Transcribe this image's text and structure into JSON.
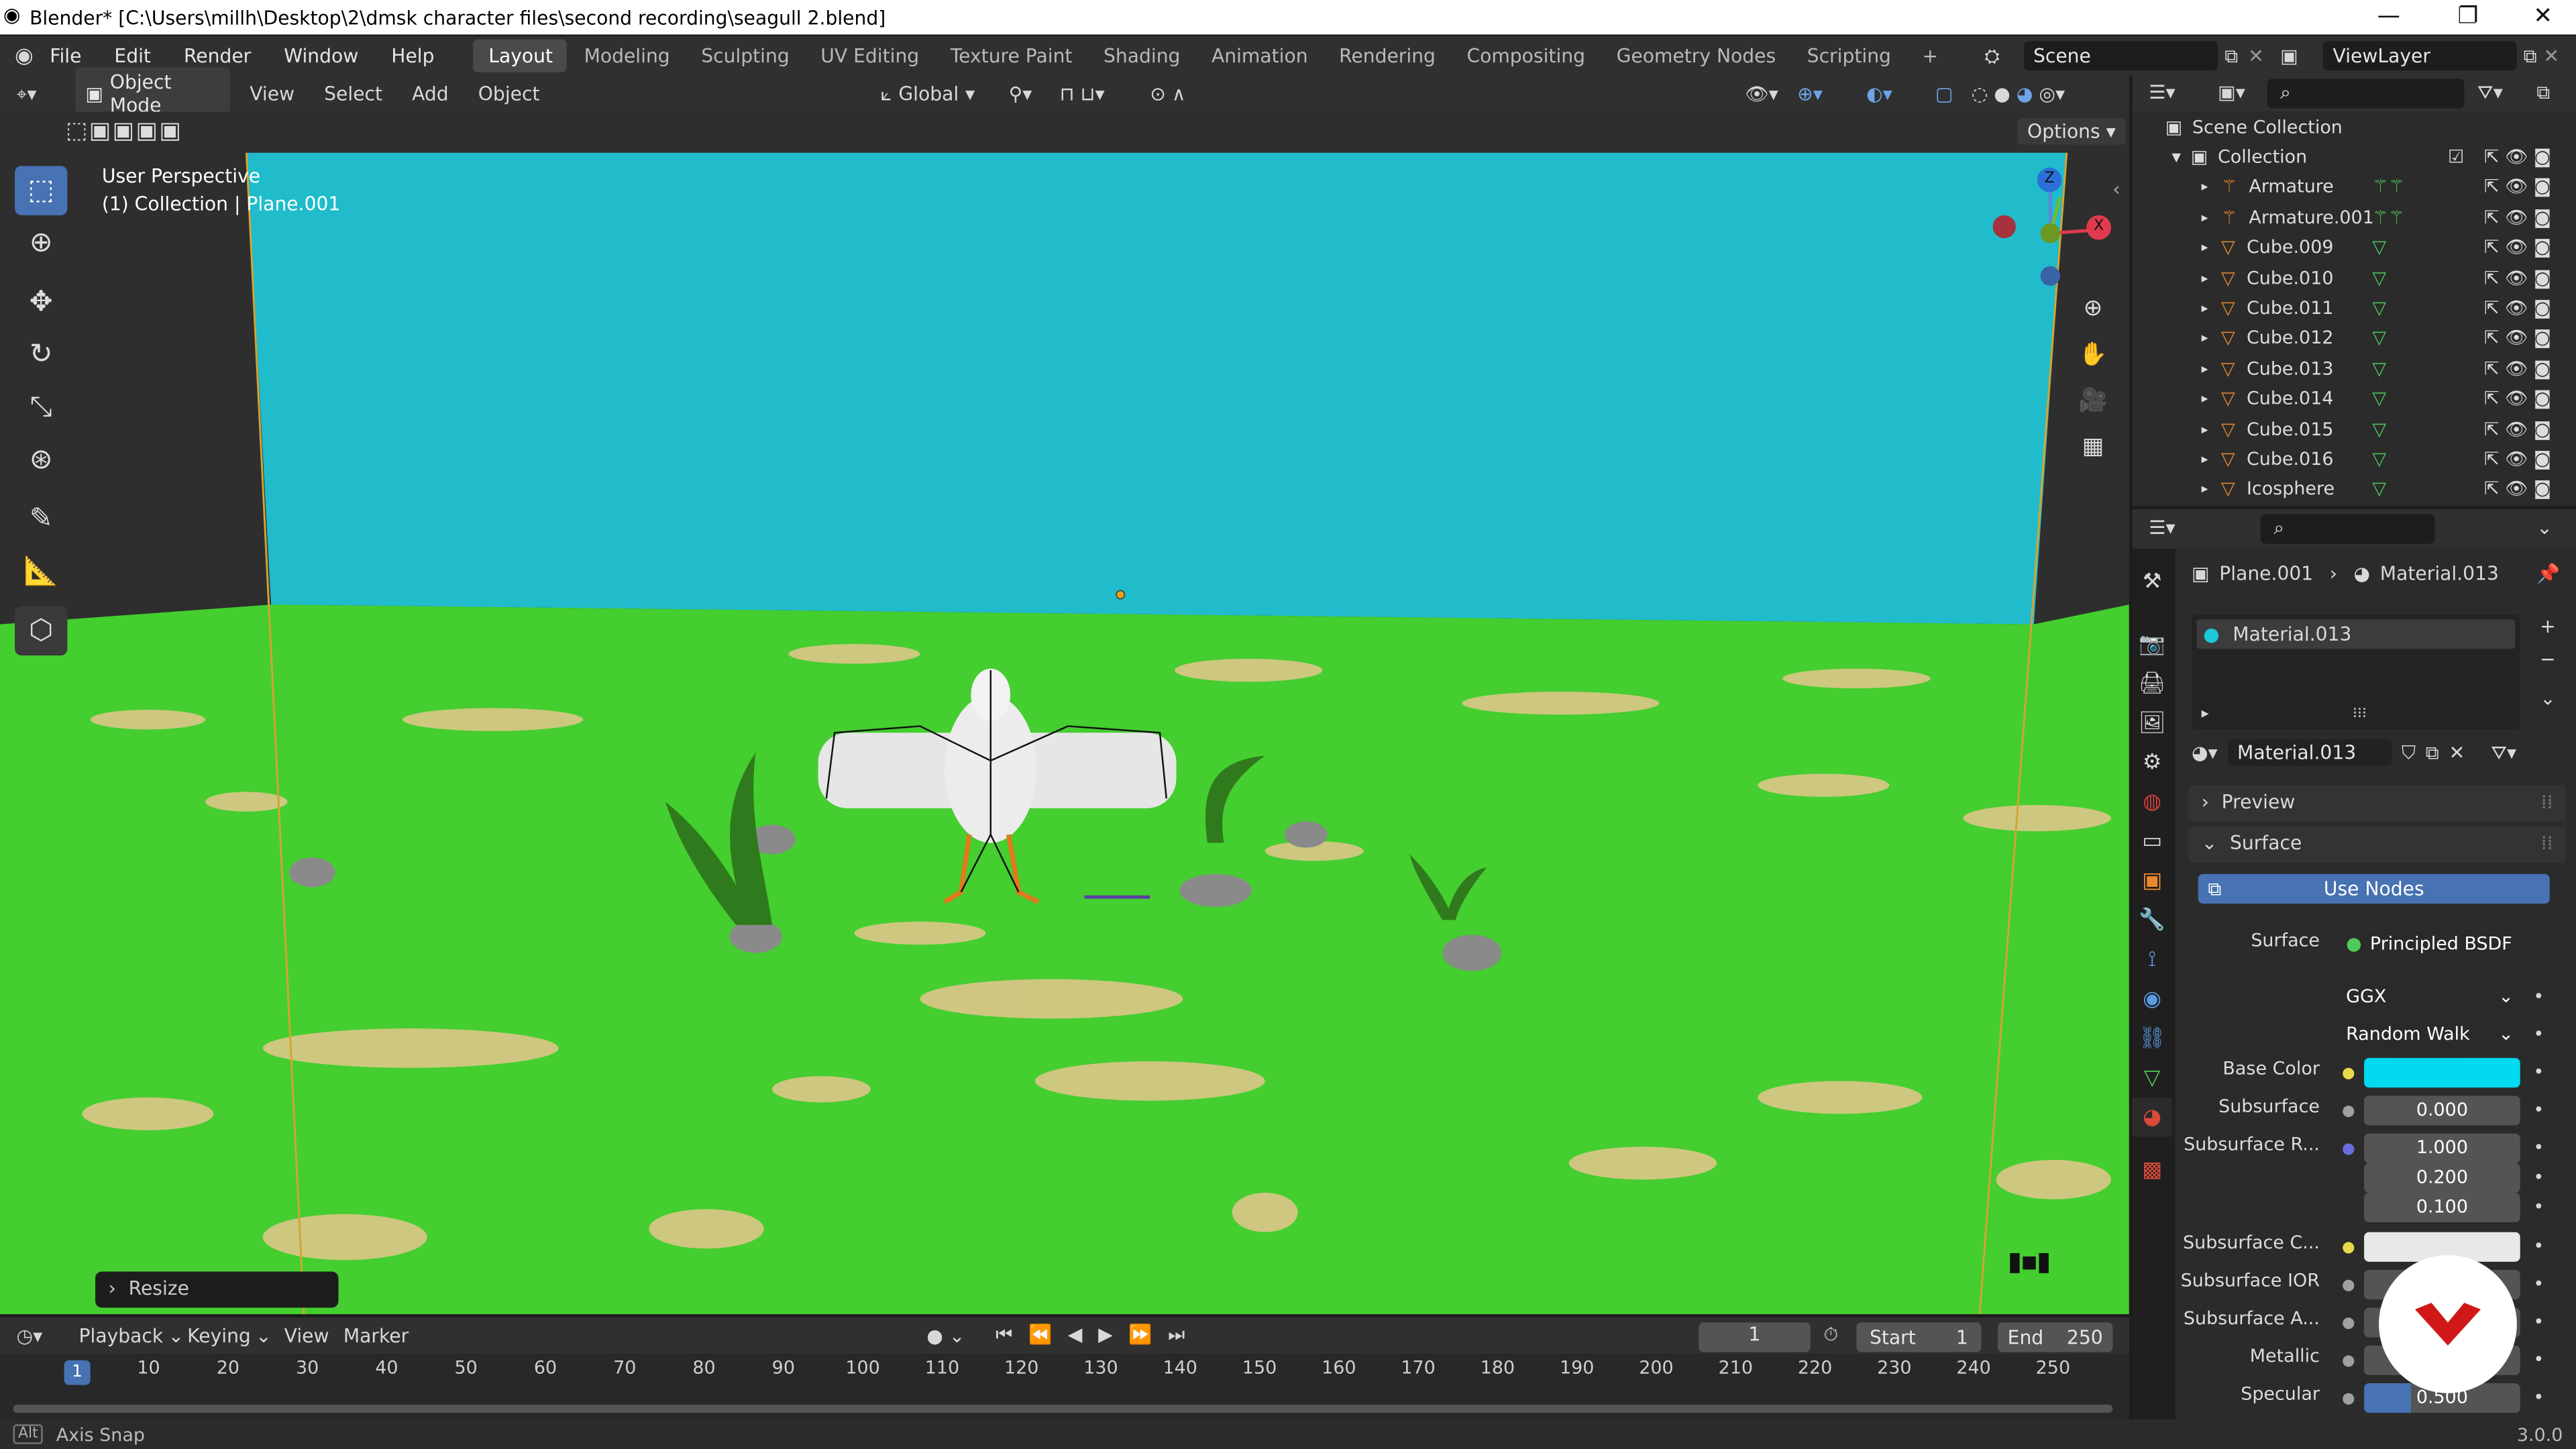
{
  "window": {
    "title": "Blender* [C:\\Users\\millh\\Desktop\\2\\dmsk character files\\second recording\\seagull 2.blend]"
  },
  "menu": [
    "File",
    "Edit",
    "Render",
    "Window",
    "Help"
  ],
  "workspaces": [
    "Layout",
    "Modeling",
    "Sculpting",
    "UV Editing",
    "Texture Paint",
    "Shading",
    "Animation",
    "Rendering",
    "Compositing",
    "Geometry Nodes",
    "Scripting"
  ],
  "active_workspace": "Layout",
  "scene": "Scene",
  "view_layer": "ViewLayer",
  "viewport_header": {
    "mode": "Object Mode",
    "menus": [
      "View",
      "Select",
      "Add",
      "Object"
    ],
    "orientation": "Global",
    "options": "Options"
  },
  "viewport": {
    "view_name": "User Perspective",
    "context": "(1) Collection | Plane.001",
    "operator_panel": "Resize",
    "gizmo": {
      "z": "Z",
      "x": "X"
    }
  },
  "outliner": {
    "root": "Scene Collection",
    "collection": "Collection",
    "items": [
      "Armature",
      "Armature.001",
      "Cube.009",
      "Cube.010",
      "Cube.011",
      "Cube.012",
      "Cube.013",
      "Cube.014",
      "Cube.015",
      "Cube.016",
      "Icosphere"
    ]
  },
  "properties": {
    "breadcrumb_object": "Plane.001",
    "breadcrumb_material": "Material.013",
    "slot": "Material.013",
    "material_name": "Material.013",
    "preview": "Preview",
    "surface_panel": "Surface",
    "use_nodes": "Use Nodes",
    "surface_label": "Surface",
    "surface_shader": "Principled BSDF",
    "distribution": "GGX",
    "subsurface_method": "Random Walk",
    "fields": [
      {
        "label": "Base Color",
        "value": "",
        "color": "#00d9f0",
        "dot": "#e8d94a"
      },
      {
        "label": "Subsurface",
        "value": "0.000",
        "dot": "#a0a0a0"
      },
      {
        "label": "Subsurface R...",
        "value": "1.000",
        "dot": "#6c6ce0"
      },
      {
        "label": "",
        "value": "0.200"
      },
      {
        "label": "",
        "value": "0.100"
      },
      {
        "label": "Subsurface C...",
        "value": "",
        "color": "#e8e8e8",
        "dot": "#e8d94a"
      },
      {
        "label": "Subsurface IOR",
        "value": "",
        "dot": "#a0a0a0"
      },
      {
        "label": "Subsurface A...",
        "value": "",
        "dot": "#a0a0a0"
      },
      {
        "label": "Metallic",
        "value": "",
        "dot": "#a0a0a0"
      },
      {
        "label": "Specular",
        "value": "0.500",
        "dot": "#a0a0a0"
      }
    ]
  },
  "timeline": {
    "menus": [
      "Playback",
      "Keying",
      "View",
      "Marker"
    ],
    "current_frame": "1",
    "start_label": "Start",
    "start": "1",
    "end_label": "End",
    "end": "250",
    "ticks": [
      "1",
      "10",
      "20",
      "30",
      "40",
      "50",
      "60",
      "70",
      "80",
      "90",
      "100",
      "110",
      "120",
      "130",
      "140",
      "150",
      "160",
      "170",
      "180",
      "190",
      "200",
      "210",
      "220",
      "230",
      "240",
      "250"
    ]
  },
  "statusbar": {
    "key": "Alt",
    "hint": "Axis Snap",
    "version": "3.0.0"
  }
}
